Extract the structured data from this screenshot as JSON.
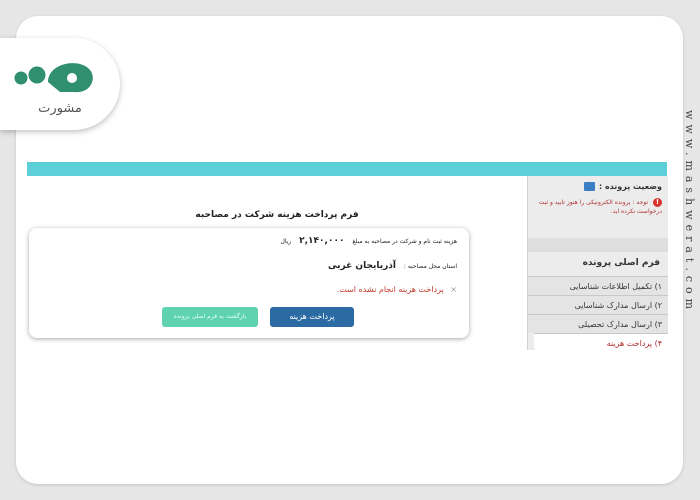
{
  "brand": {
    "logo_text": "مشورت",
    "site_url": "www.mashwerat.com"
  },
  "form": {
    "title": "فرم پرداخت هزینه شرکت در مصاحبه",
    "fee_label": "هزینه ثبت نام و شرکت در مصاحبه به مبلغ",
    "fee_amount": "۲,۱۴۰,۰۰۰",
    "fee_unit": "ریال",
    "province_label": "استان محل مصاحبه :",
    "province_value": "آذربایجان غربی",
    "status_message": "پرداخت هزینه انجام نشده است.",
    "pay_button": "پرداخت هزینه",
    "back_button": "بازگشت به فرم اصلی پرونده"
  },
  "sidebar": {
    "status_title": "وضعیت پرونده :",
    "note": "توجه : پرونده الکترونیکی را هنوز تایید و ثبت درخواست نکرده اید.",
    "menu_title": "فرم اصلی پرونده",
    "items": [
      {
        "label": "۱) تکمیل اطلاعات شناسایی"
      },
      {
        "label": "۲) ارسال مدارک شناسایی"
      },
      {
        "label": "۳) ارسال مدارک تحصیلی"
      },
      {
        "label": "۴) پرداخت هزینه"
      }
    ]
  },
  "colors": {
    "topbar": "#5ccfd8",
    "pay_button": "#2b6aa3",
    "back_button": "#5fd3b0",
    "error": "#c0392b"
  },
  "icons": {
    "logo": "mashwerat-logo-icon",
    "folder": "folder-icon",
    "alert": "alert-icon",
    "cross": "cross-icon"
  }
}
